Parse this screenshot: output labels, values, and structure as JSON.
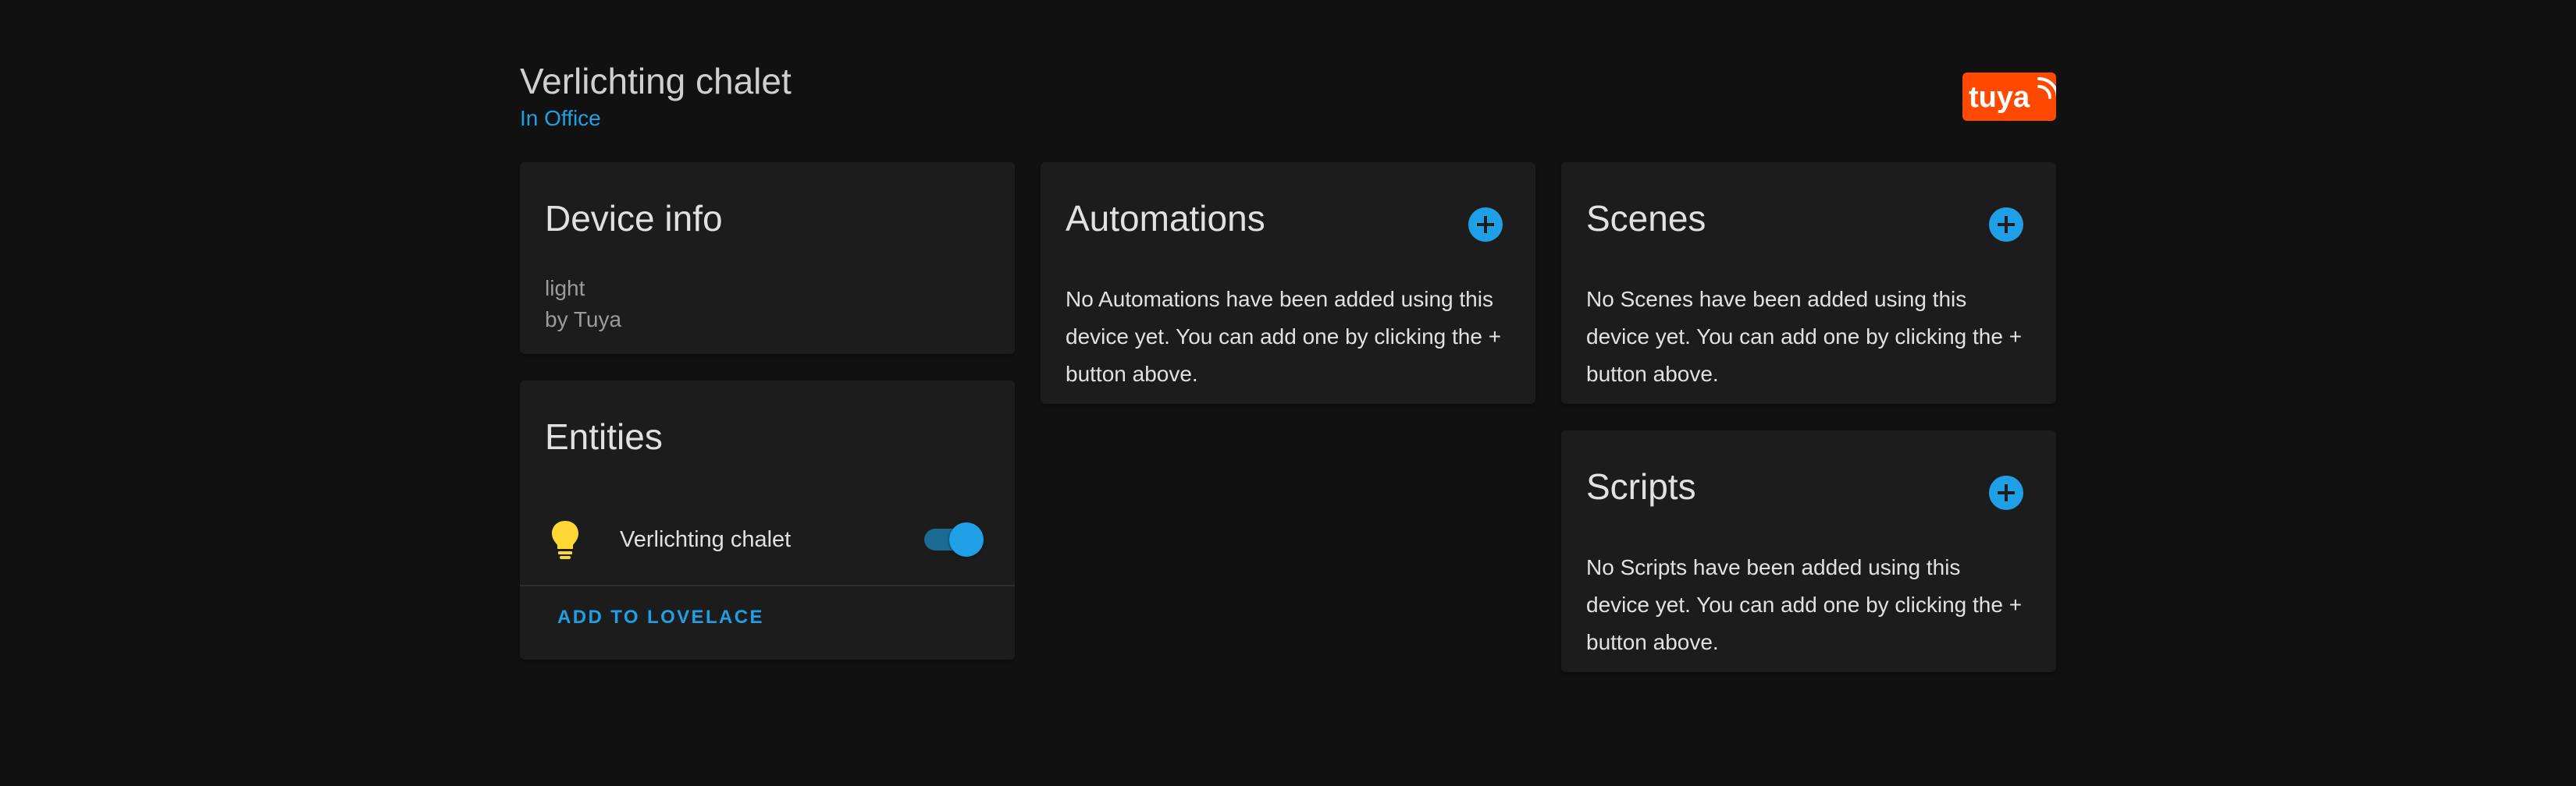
{
  "header": {
    "title": "Verlichting chalet",
    "area": "In Office",
    "brand_logo_text": "tuya"
  },
  "device_info": {
    "title": "Device info",
    "model": "light",
    "manufacturer": "by Tuya"
  },
  "entities": {
    "title": "Entities",
    "items": [
      {
        "name": "Verlichting chalet",
        "icon": "lightbulb-icon",
        "state": "on"
      }
    ],
    "add_to_lovelace": "ADD TO LOVELACE"
  },
  "automations": {
    "title": "Automations",
    "empty_text": "No Automations have been added using this device yet. You can add one by clicking the + button above."
  },
  "scenes": {
    "title": "Scenes",
    "empty_text": "No Scenes have been added using this device yet. You can add one by clicking the + button above."
  },
  "scripts": {
    "title": "Scripts",
    "empty_text": "No Scripts have been added using this device yet. You can add one by clicking the + button above."
  },
  "colors": {
    "background": "#111111",
    "card": "#1c1c1c",
    "accent": "#1e9fe6",
    "bulb": "#fdd835",
    "tuya_brand": "#ff4800"
  }
}
